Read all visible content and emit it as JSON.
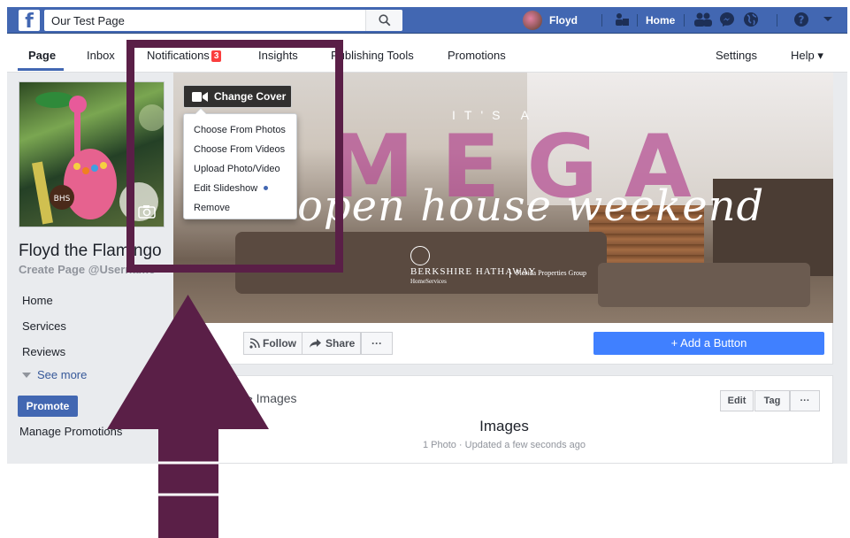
{
  "topbar": {
    "search_value": "Our Test Page",
    "user_name": "Floyd",
    "home_label": "Home",
    "accent": "#4267b2"
  },
  "page_tabs": {
    "page": "Page",
    "inbox": "Inbox",
    "notifications": "Notifications",
    "notifications_badge": "3",
    "insights": "Insights",
    "publishing_tools": "Publishing Tools",
    "promotions": "Promotions",
    "settings": "Settings",
    "help": "Help ▾"
  },
  "sidebar": {
    "page_name": "Floyd the Flamingo",
    "username_link": "Create Page @Username",
    "items": [
      {
        "label": "Home"
      },
      {
        "label": "Services"
      },
      {
        "label": "Reviews"
      }
    ],
    "see_more": "See more",
    "promote": "Promote",
    "manage_promotions": "Manage Promotions"
  },
  "cover": {
    "change_cover_label": "Change Cover",
    "menu_items": [
      {
        "label": "Choose From Photos"
      },
      {
        "label": "Choose From Videos"
      },
      {
        "label": "Upload Photo/Video"
      },
      {
        "label": "Edit Slideshow"
      },
      {
        "label": "Remove"
      }
    ],
    "art_its": "IT'S A",
    "art_mega": "MEGA",
    "art_script": "open house weekend",
    "art_brand": "BERKSHIRE HATHAWAY",
    "art_brand_sub": "HomeServices",
    "art_group": "Florida Properties Group"
  },
  "actions": {
    "follow": "Follow",
    "share": "Share",
    "more": "···",
    "add_button": "+ Add a Button"
  },
  "images_card": {
    "breadcrumb": "Albums > Images",
    "edit": "Edit",
    "tag": "Tag",
    "more": "···",
    "title": "Images",
    "subtitle": "1 Photo · Updated a few seconds ago"
  },
  "annotation": {
    "color": "#5a1f47"
  }
}
